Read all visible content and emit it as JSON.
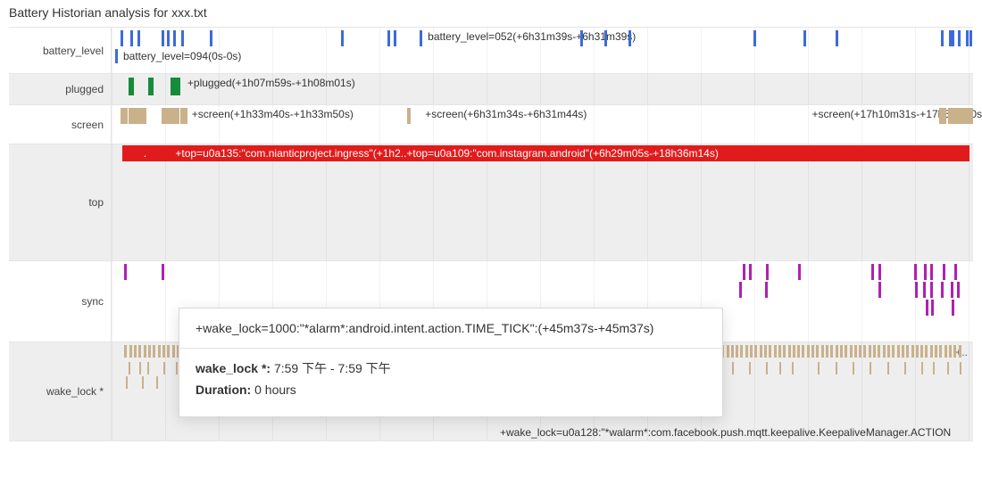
{
  "title": "Battery Historian analysis for xxx.txt",
  "chart_data": {
    "type": "timeline",
    "x_range_hours": [
      0,
      24
    ],
    "lanes": [
      {
        "id": "battery_level",
        "label": "battery_level",
        "color": "#3b6bdb",
        "ticks_pct": [
          1,
          2.2,
          3,
          5.8,
          6.4,
          7.2,
          8.1,
          11.4,
          26.6,
          32,
          32.7,
          35.7,
          54.4,
          57.2,
          60,
          74.5,
          80.3,
          84,
          96.3,
          97.2,
          97.5,
          98.2,
          99.2,
          99.6
        ],
        "subline_tick_pct": 0.6,
        "subline_label": "battery_level=094(0s-0s)",
        "annotations": [
          {
            "pct": 36.7,
            "text": "battery_level=052(+6h31m39s-+6h31m39s)"
          }
        ]
      },
      {
        "id": "plugged",
        "label": "plugged",
        "color": "#168b3a",
        "alt": true,
        "ticks_pct": [
          2.0,
          4.3,
          6.8,
          7.4
        ],
        "annotations": [
          {
            "pct": 8.8,
            "text": "+plugged(+1h07m59s-+1h08m01s)"
          }
        ]
      },
      {
        "id": "screen",
        "label": "screen",
        "color": "#c9b18a",
        "ticks_pct": [
          1,
          2,
          2.5,
          3.2,
          5.8,
          6.3,
          7.0,
          8.0,
          34.3,
          96.1,
          97.1,
          97.6,
          98.3,
          99.2
        ],
        "wide_ticks_pct": [
          1,
          2,
          2.5,
          3.2,
          5.8,
          6.3,
          7.0,
          8.0,
          96.1,
          97.1,
          97.6,
          98.3,
          99.2
        ],
        "annotations": [
          {
            "pct": 9.3,
            "text": "+screen(+1h33m40s-+1h33m50s)"
          },
          {
            "pct": 36.4,
            "text": "+screen(+6h31m34s-+6h31m44s)"
          },
          {
            "pct": 81.3,
            "text": "+screen(+17h10m31s-+17h50m00s)"
          }
        ]
      },
      {
        "id": "top",
        "label": "top",
        "color": "#e11b1b",
        "alt": true,
        "tall": true,
        "ribbon": {
          "start_pct": 1.2,
          "end_pct": 99.6
        },
        "annotations": [
          {
            "pct": 3.7,
            "text": ".",
            "red": true
          },
          {
            "pct": 7.4,
            "text": "+top=u0a135:\"com.nianticproject.ingress\"(+1h2..+top=u0a109:\"com.instagram.android\"(+6h29m05s-+18h36m14s)",
            "red": true
          }
        ]
      },
      {
        "id": "sync",
        "label": "sync",
        "color": "#b020b0",
        "tall": true,
        "rows": [
          [
            1.5,
            5.8,
            73.3,
            74.0,
            76.0,
            79.7,
            88.2,
            89.0,
            93.2,
            94.3,
            95.0,
            96.5,
            97.8
          ],
          [
            72.8,
            75.9,
            89.0,
            93.3,
            94.2,
            95.0,
            96.3,
            97.4,
            98.1
          ],
          [
            94.5,
            95.1,
            97.5
          ]
        ]
      },
      {
        "id": "wake_lock",
        "label": "wake_lock *",
        "color": "#c9b18a",
        "alt": true,
        "tall": true,
        "dense_ranges_pct": [
          [
            1.5,
            98.5
          ]
        ],
        "thin_rows_pct": [
          [
            2,
            3.2,
            4.1,
            6.0,
            7.5,
            9.0,
            10.3,
            11.5,
            13,
            15,
            16.2,
            17.5,
            19,
            20.8,
            22,
            24,
            25.5,
            27.2,
            28.6,
            30,
            31.2,
            33,
            34.5,
            35.8,
            37,
            38.2,
            40,
            41.5,
            43,
            45,
            46.2,
            48,
            50.1,
            51.5,
            53,
            54.3,
            55.8,
            57.2,
            59,
            60.4,
            62,
            64,
            65.5,
            67,
            68.1,
            69,
            70.3,
            72,
            74,
            76,
            77.5,
            79,
            82,
            84,
            86,
            88,
            90,
            92,
            94,
            95.3,
            97,
            98.4
          ],
          [
            1.7,
            3.5,
            5.2,
            8.2,
            10.8,
            12.4,
            16.2,
            18.3,
            23.5,
            27.5,
            35.5,
            43.5
          ]
        ],
        "right_overflow": "+..",
        "footnote": "+wake_lock=u0a128:\"*walarm*:com.facebook.push.mqtt.keepalive.KeepaliveManager.ACTION"
      }
    ]
  },
  "tooltip": {
    "head": "+wake_lock=1000:\"*alarm*:android.intent.action.TIME_TICK\":(+45m37s-+45m37s)",
    "series_label": "wake_lock *:",
    "time_range": "7:59 下午 - 7:59 下午",
    "duration_label": "Duration:",
    "duration_value": "0 hours"
  }
}
